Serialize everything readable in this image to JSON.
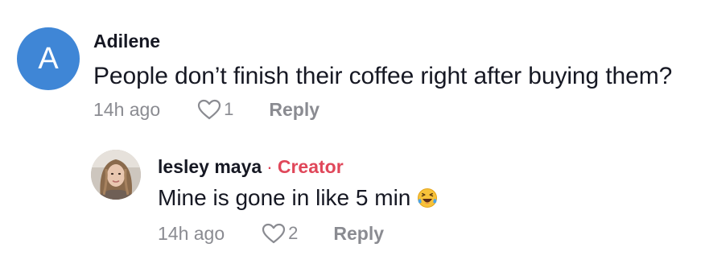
{
  "comment": {
    "avatar_letter": "A",
    "avatar_color": "#3f86d6",
    "username": "Adilene",
    "text": "People don’t finish their coffee right after buying them?",
    "time": "14h ago",
    "likes": "1",
    "reply_label": "Reply"
  },
  "reply": {
    "username": "lesley maya",
    "separator": "·",
    "creator_badge": "Creator",
    "text": "Mine is gone in like 5 min",
    "emoji": "face-with-tears-of-joy-icon",
    "time": "14h ago",
    "likes": "2",
    "reply_label": "Reply"
  },
  "colors": {
    "text_primary": "#161823",
    "text_secondary": "#8a8b91",
    "creator_accent": "#e0475a"
  }
}
